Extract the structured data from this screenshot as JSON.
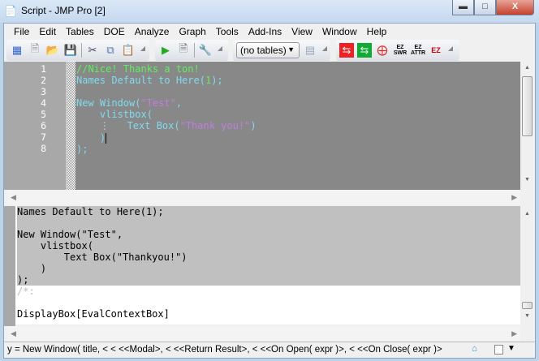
{
  "window": {
    "title": "Script - JMP Pro [2]",
    "buttons": [
      "minimize",
      "maximize",
      "close"
    ]
  },
  "menu": [
    "File",
    "Edit",
    "Tables",
    "DOE",
    "Analyze",
    "Graph",
    "Tools",
    "Add-Ins",
    "View",
    "Window",
    "Help"
  ],
  "toolbar": {
    "table_select": "(no tables)",
    "ez_swr": "EZ SWR",
    "ez_attr": "EZ ATTR",
    "ez": "EZ"
  },
  "editor": {
    "line_numbers": [
      "1",
      "2",
      "3",
      "4",
      "5",
      "6",
      "7",
      "8"
    ]
  },
  "log": {
    "lines": [
      "Names Default to Here(1);",
      "",
      "New Window(\"Test\",",
      "    vlistbox(",
      "        Text Box(\"Thankyou!\")",
      "    )",
      ");"
    ],
    "comment": "/*:",
    "result": "DisplayBox[EvalContextBox]"
  },
  "status": {
    "text": "y = New Window( title, < < <<Modal>, < <<Return Result>, < <<On Open( expr )>, < <<On Close( expr )>"
  }
}
